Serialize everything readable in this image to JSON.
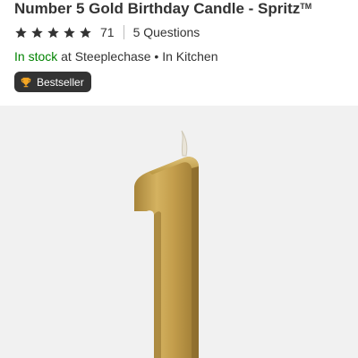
{
  "product": {
    "title": "Number 5 Gold Birthday Candle - Spritz",
    "trademark": "TM"
  },
  "rating": {
    "stars": 5,
    "count": "71",
    "questions": "5 Questions",
    "star_color": "#333333"
  },
  "availability": {
    "status": "In stock",
    "location": "at Steeplechase • In Kitchen",
    "status_color": "#008300"
  },
  "badge": {
    "label": "Bestseller",
    "icon": "trophy-icon",
    "icon_color": "#f5a623"
  },
  "image": {
    "alt": "Gold candle shaped like the numeral 1",
    "background": "#f1f1f1",
    "candle_color": "#c8a44a"
  }
}
